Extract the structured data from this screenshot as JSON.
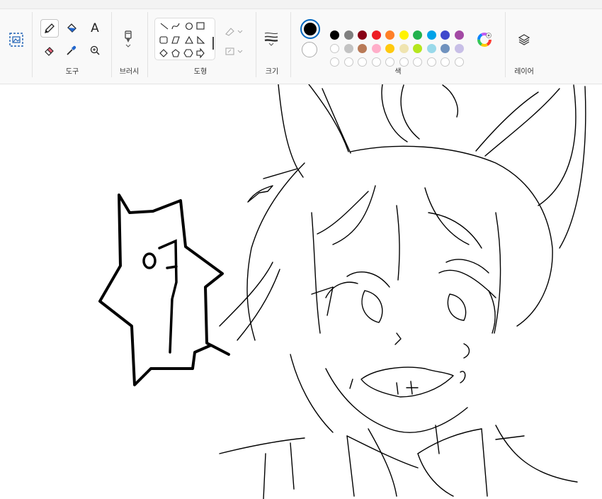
{
  "ribbon": {
    "groups": {
      "tools": "도구",
      "brushes": "브러시",
      "shapes": "도형",
      "size": "크기",
      "colors": "색",
      "layers": "레이어"
    }
  },
  "icons": {
    "select": "select-region-icon",
    "pencil": "pencil-icon",
    "fill": "fill-bucket-icon",
    "text": "A",
    "eraser": "eraser-icon",
    "picker": "color-picker-icon",
    "zoom": "magnifier-icon",
    "brush": "brush-icon",
    "size": "stroke-size-icon",
    "edit_colors": "color-wheel-icon",
    "layers": "layers-icon"
  },
  "colors": {
    "primary": "#000000",
    "secondary": "#ffffff",
    "palette_row1": [
      "#000000",
      "#7f7f7f",
      "#880015",
      "#ed1c24",
      "#ff7f27",
      "#fff200",
      "#22b14c",
      "#00a2e8",
      "#3f48cc",
      "#a349a4"
    ],
    "palette_row2": [
      "#ffffff",
      "#c3c3c3",
      "#b97a57",
      "#ffaec9",
      "#ffc90e",
      "#efe4b0",
      "#b5e61d",
      "#99d9ea",
      "#7092be",
      "#c8bfe7"
    ],
    "accent": "#0067c0"
  },
  "canvas": {
    "speech_text": "이"
  }
}
